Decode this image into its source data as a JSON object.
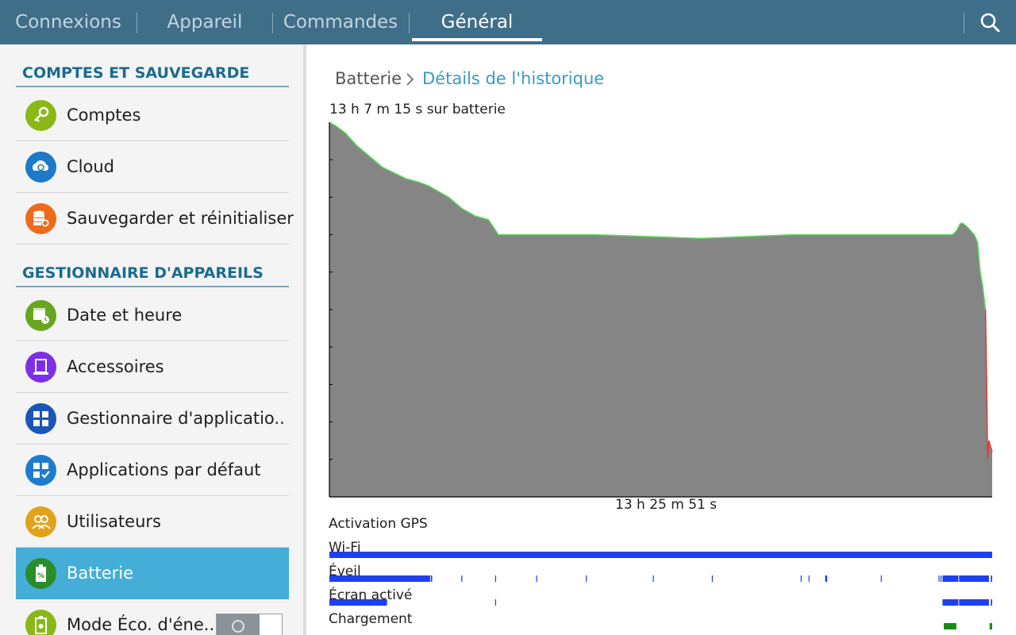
{
  "tabs": [
    {
      "label": "Connexions",
      "active": false
    },
    {
      "label": "Appareil",
      "active": false
    },
    {
      "label": "Commandes",
      "active": false
    },
    {
      "label": "Général",
      "active": true
    }
  ],
  "sidebar": {
    "sections": [
      {
        "title": "COMPTES ET SAUVEGARDE"
      },
      {
        "title": "GESTIONNAIRE D'APPAREILS"
      }
    ],
    "items": [
      {
        "label": "Comptes",
        "icon": "key-icon",
        "color": "#8bb817"
      },
      {
        "label": "Cloud",
        "icon": "cloud-sync-icon",
        "color": "#1d7ac9"
      },
      {
        "label": "Sauvegarder et réinitialiser",
        "icon": "backup-database-icon",
        "color": "#ef6a1a"
      },
      {
        "label": "Date et heure",
        "icon": "calendar-clock-icon",
        "color": "#67a61e"
      },
      {
        "label": "Accessoires",
        "icon": "accessory-icon",
        "color": "#7c2fe8"
      },
      {
        "label": "Gestionnaire d'applicatio..",
        "icon": "app-grid-icon",
        "color": "#1a55b8"
      },
      {
        "label": "Applications par défaut",
        "icon": "default-apps-icon",
        "color": "#1e7ccf"
      },
      {
        "label": "Utilisateurs",
        "icon": "users-icon",
        "color": "#e2a21a"
      },
      {
        "label": "Batterie",
        "icon": "battery-icon",
        "color": "#2a8c2a",
        "selected": true
      },
      {
        "label": "Mode Éco. d'éne..",
        "icon": "eco-battery-icon",
        "color": "#8bb817",
        "toggle": false
      }
    ]
  },
  "main": {
    "breadcrumb_parent": "Batterie",
    "breadcrumb_current": "Détails de l'historique",
    "battery_summary": "13 h 7 m 15 s sur batterie",
    "x_axis_label": "13 h 25 m 51 s",
    "rows": [
      {
        "label": "Activation GPS"
      },
      {
        "label": "Wi-Fi"
      },
      {
        "label": "Éveil"
      },
      {
        "label": "Écran activé"
      },
      {
        "label": "Chargement"
      }
    ]
  },
  "chart_data": {
    "type": "area",
    "x_unit": "fraction of 13 h 25 m 51 s",
    "y_unit": "battery level (fraction)",
    "ylim": [
      0,
      1
    ],
    "xlim": [
      0,
      1
    ],
    "grid": false,
    "fill_color": "#858585",
    "line_color": "#5fe05f",
    "low_line_color": "#e03c28",
    "points": [
      [
        0.0,
        1.0
      ],
      [
        0.01,
        0.99
      ],
      [
        0.025,
        0.97
      ],
      [
        0.04,
        0.94
      ],
      [
        0.06,
        0.91
      ],
      [
        0.08,
        0.88
      ],
      [
        0.115,
        0.85
      ],
      [
        0.135,
        0.84
      ],
      [
        0.15,
        0.83
      ],
      [
        0.16,
        0.82
      ],
      [
        0.18,
        0.8
      ],
      [
        0.2,
        0.77
      ],
      [
        0.22,
        0.75
      ],
      [
        0.24,
        0.74
      ],
      [
        0.255,
        0.7
      ],
      [
        0.3,
        0.7
      ],
      [
        0.4,
        0.7
      ],
      [
        0.56,
        0.69
      ],
      [
        0.7,
        0.7
      ],
      [
        0.84,
        0.7
      ],
      [
        0.94,
        0.7
      ],
      [
        0.946,
        0.71
      ],
      [
        0.952,
        0.73
      ],
      [
        0.956,
        0.73
      ],
      [
        0.963,
        0.72
      ],
      [
        0.973,
        0.7
      ],
      [
        0.978,
        0.68
      ],
      [
        0.982,
        0.6
      ],
      [
        0.986,
        0.56
      ],
      [
        0.99,
        0.5
      ],
      [
        0.992,
        0.27
      ],
      [
        0.993,
        0.1
      ],
      [
        0.995,
        0.15
      ],
      [
        1.0,
        0.12
      ]
    ],
    "low_segment_start": 0.99,
    "timelines": [
      {
        "name": "Activation GPS",
        "color": "#1f3ff0",
        "segments": []
      },
      {
        "name": "Wi-Fi",
        "color": "#1f3ff0",
        "segments": [
          [
            0.0,
            1.0
          ]
        ]
      },
      {
        "name": "Éveil",
        "color": "#1f3ff0",
        "segments": [
          [
            0.0,
            0.152
          ],
          [
            0.153,
            0.155
          ],
          [
            0.199,
            0.2
          ],
          [
            0.25,
            0.251
          ],
          [
            0.312,
            0.313
          ],
          [
            0.387,
            0.388
          ],
          [
            0.488,
            0.489
          ],
          [
            0.577,
            0.578
          ],
          [
            0.711,
            0.712
          ],
          [
            0.723,
            0.724
          ],
          [
            0.748,
            0.751
          ],
          [
            0.832,
            0.833
          ],
          [
            0.919,
            0.92
          ],
          [
            0.922,
            0.923
          ],
          [
            0.925,
            0.949
          ],
          [
            0.95,
            0.995
          ],
          [
            0.998,
            1.0
          ]
        ]
      },
      {
        "name": "Écran activé",
        "color": "#1f3ff0",
        "segments": [
          [
            0.0,
            0.087
          ],
          [
            0.25,
            0.251
          ],
          [
            0.925,
            0.949
          ],
          [
            0.95,
            0.995
          ],
          [
            0.998,
            1.0
          ]
        ]
      },
      {
        "name": "Chargement",
        "color": "#1a8a1a",
        "segments": [
          [
            0.927,
            0.946
          ],
          [
            0.996,
            1.0
          ]
        ]
      }
    ]
  }
}
